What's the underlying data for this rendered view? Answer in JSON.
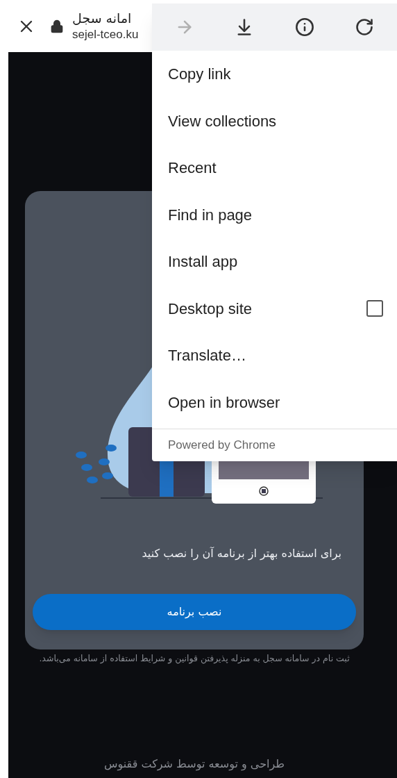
{
  "toolbar": {
    "title": "امانه سجل",
    "url": "sejel-tceo.ku"
  },
  "menu": {
    "top_actions": [
      {
        "kind": "forward",
        "disabled": true
      },
      {
        "kind": "download",
        "disabled": false
      },
      {
        "kind": "info",
        "disabled": false
      },
      {
        "kind": "reload",
        "disabled": false
      }
    ],
    "items": [
      {
        "label": "Copy link",
        "kind": "plain"
      },
      {
        "label": "View collections",
        "kind": "plain"
      },
      {
        "label": "Recent",
        "kind": "plain"
      },
      {
        "label": "Find in page",
        "kind": "plain"
      },
      {
        "label": "Install app",
        "kind": "plain"
      },
      {
        "label": "Desktop site",
        "kind": "checkbox",
        "checked": false
      },
      {
        "label": "Translate…",
        "kind": "plain"
      },
      {
        "label": "Open in browser",
        "kind": "plain"
      }
    ],
    "footer": "Powered by Chrome"
  },
  "card": {
    "message": "برای استفاده بهتر از برنامه آن را نصب کنید",
    "button": "نصب برنامه"
  },
  "terms_note": "ثبت نام در سامانه سجل به منزله پذیرفتن قوانین و شرایط استفاده از سامانه می‌باشد.",
  "footer": "طراحی و توسعه توسط شرکت ققنوس"
}
